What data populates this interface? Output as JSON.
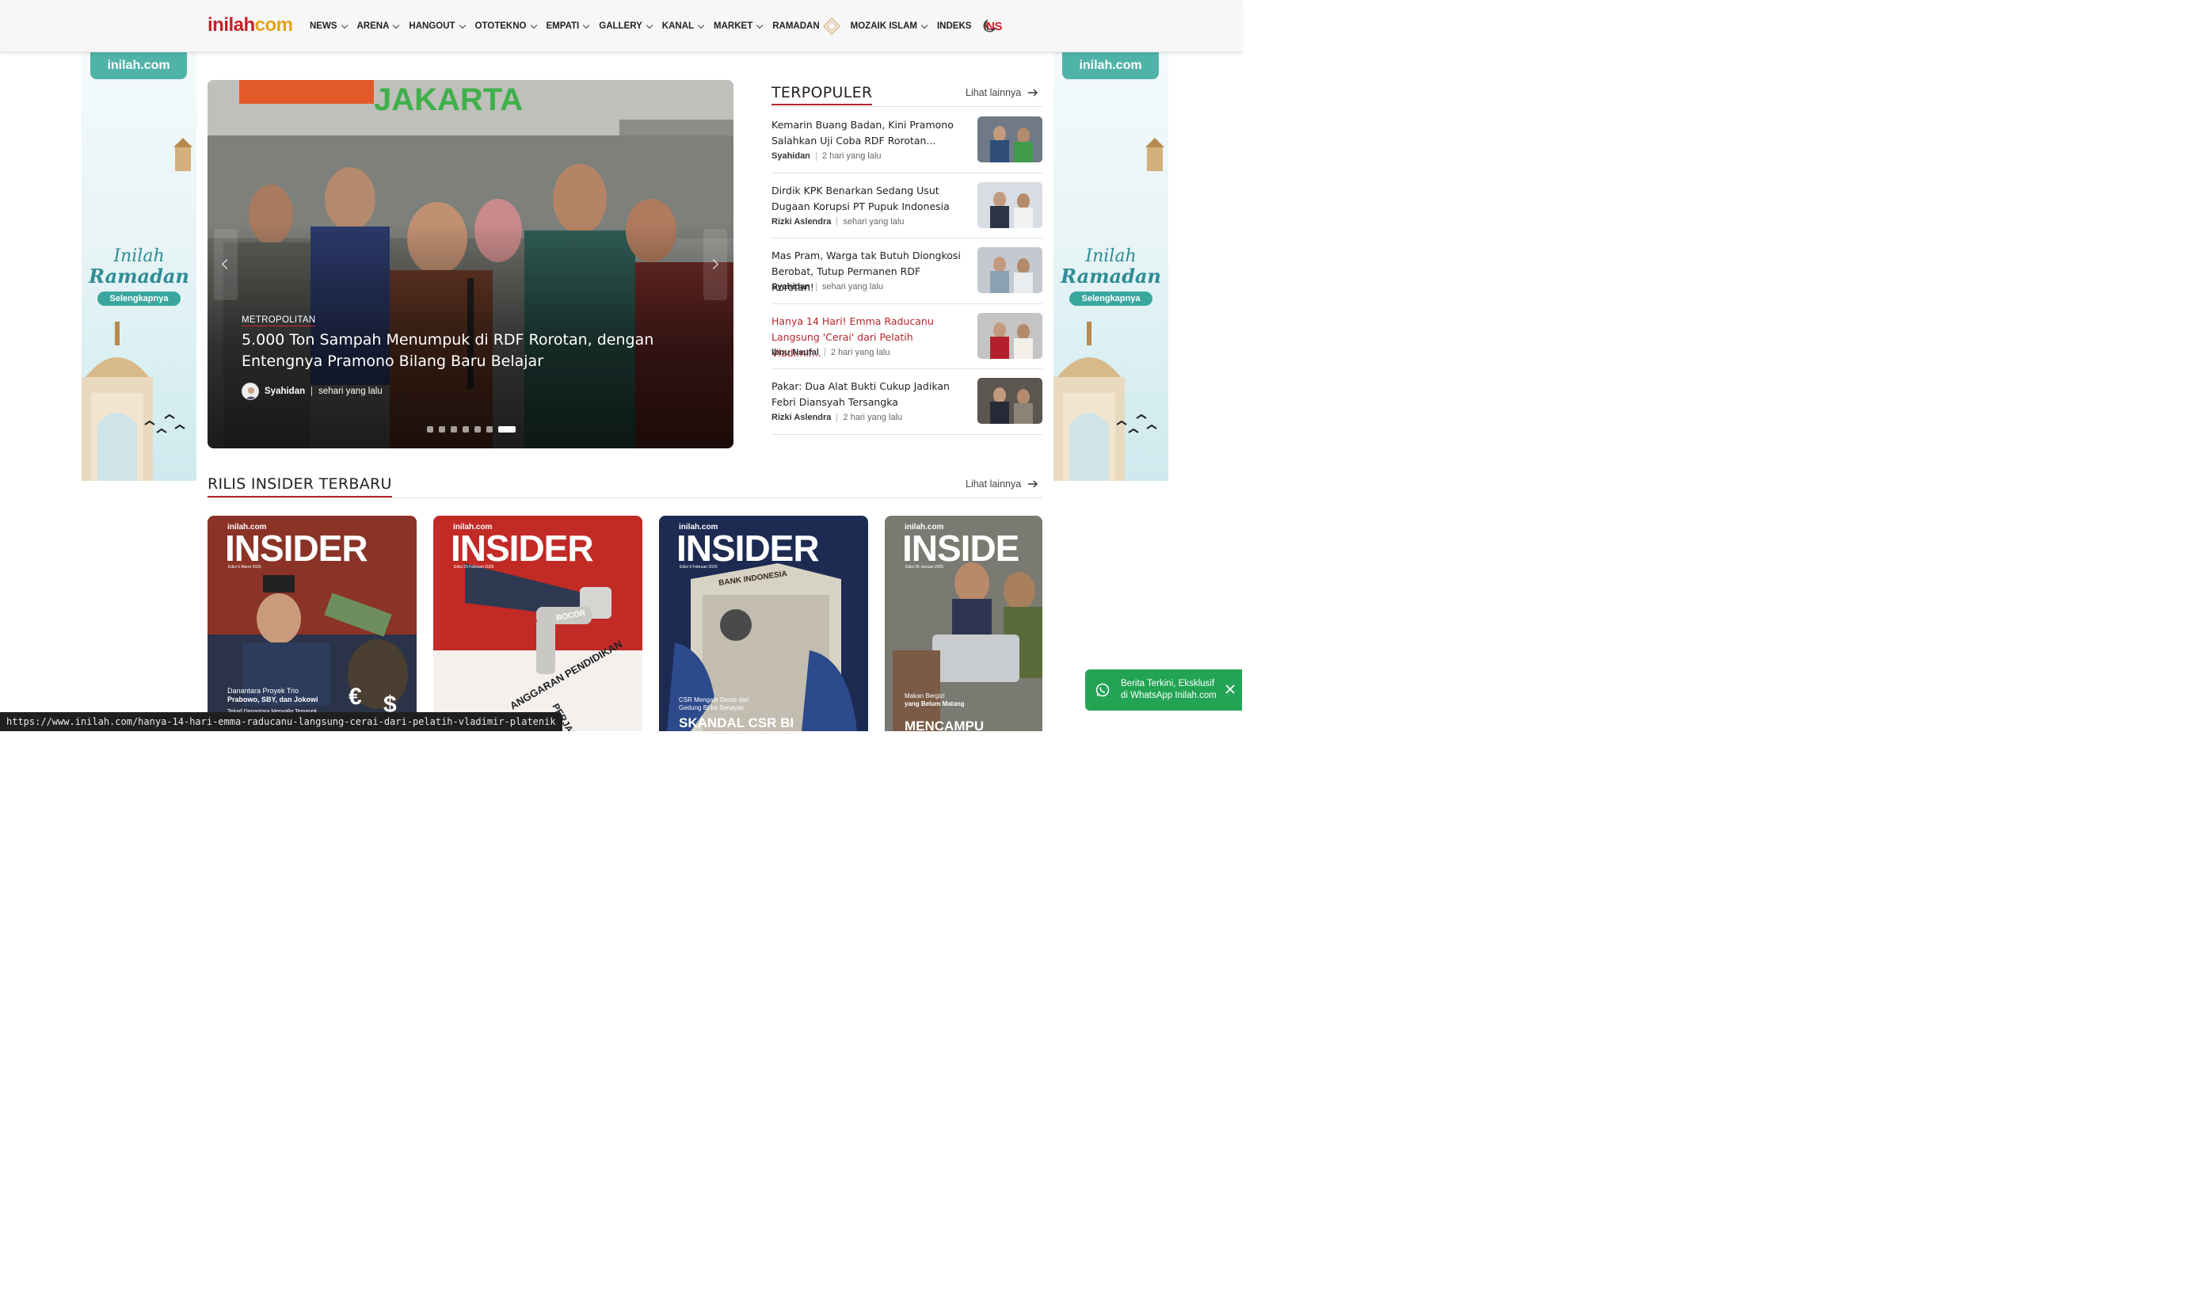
{
  "header": {
    "logo_part1": "inilah",
    "logo_part2": "com",
    "nav": [
      {
        "label": "NEWS",
        "has_dropdown": true
      },
      {
        "label": "ARENA",
        "has_dropdown": true
      },
      {
        "label": "HANGOUT",
        "has_dropdown": true
      },
      {
        "label": "OTOTEKNO",
        "has_dropdown": true
      },
      {
        "label": "EMPATI",
        "has_dropdown": true
      },
      {
        "label": "GALLERY",
        "has_dropdown": true
      },
      {
        "label": "KANAL",
        "has_dropdown": true
      },
      {
        "label": "MARKET",
        "has_dropdown": true
      },
      {
        "label": "RAMADAN",
        "has_dropdown": false
      },
      {
        "label": "MOZAIK ISLAM",
        "has_dropdown": true
      },
      {
        "label": "INDEKS",
        "has_dropdown": false
      }
    ],
    "ins_label": "INS",
    "theme_icon": "moon-icon"
  },
  "side_banner": {
    "logo": "inilah.com",
    "title_line1": "Inilah",
    "title_line2": "Ramadan",
    "button": "Selengkapnya"
  },
  "hero": {
    "category": "METROPOLITAN",
    "title": "5.000 Ton Sampah Menumpuk di RDF Rorotan, dengan Entengnya Pramono Bilang Baru Belajar",
    "author": "Syahidan",
    "time": "sehari yang lalu",
    "sign_text": "JAKARTA",
    "slide_count": 7,
    "active_slide": 7
  },
  "popular": {
    "title": "TERPOPULER",
    "see_more": "Lihat lainnya",
    "items": [
      {
        "title": "Kemarin Buang Badan, Kini Pramono Salahkan Uji Coba RDF Rorotan...",
        "author": "Syahidan",
        "time": "2 hari yang lalu",
        "highlighted": false
      },
      {
        "title": "Dirdik KPK Benarkan Sedang Usut Dugaan Korupsi PT Pupuk Indonesia",
        "author": "Rizki Aslendra",
        "time": "sehari yang lalu",
        "highlighted": false
      },
      {
        "title": "Mas Pram, Warga tak Butuh Diongkosi Berobat, Tutup Permanen RDF Rorotan!",
        "author": "Syahidan",
        "time": "sehari yang lalu",
        "highlighted": false
      },
      {
        "title": "Hanya 14 Hari! Emma Raducanu Langsung 'Cerai' dari Pelatih Vladimir...",
        "author": "Ibnu Naufal",
        "time": "2 hari yang lalu",
        "highlighted": true
      },
      {
        "title": "Pakar: Dua Alat Bukti Cukup Jadikan Febri Diansyah Tersangka",
        "author": "Rizki Aslendra",
        "time": "2 hari yang lalu",
        "highlighted": false
      }
    ]
  },
  "insider": {
    "title": "RILIS INSIDER TERBARU",
    "see_more": "Lihat lainnya",
    "covers": [
      {
        "brand_small": "inilah.com",
        "brand": "INSIDER",
        "edition": "Edisi 6 Maret 2025",
        "caption_line1": "Danantara Proyek Trio",
        "caption_line2": "Prabowo, SBY, dan Jokowi",
        "caption_line3": "Tekad Danantara Menyalip Temasek",
        "bg": "#8a3326"
      },
      {
        "brand_small": "inilah.com",
        "brand": "INSIDER",
        "edition": "Edisi 23 Februari 2025",
        "tap_label": "BOCOR",
        "bg": "#c22a26"
      },
      {
        "brand_small": "inilah.com",
        "brand": "INSIDER",
        "edition": "Edisi 9 Februari 2025",
        "building_label": "BANK INDONESIA",
        "caption_line1": "CSR Mengalir Deras dari",
        "caption_line2": "Gedung BI ke Senayan",
        "headline": "SKANDAL CSR BI",
        "bg": "#1d2a52"
      },
      {
        "brand_small": "inilah.com",
        "brand": "INSIDE",
        "edition": "Edisi 26 Januari 2025",
        "caption_line1": "Makan Bergizi",
        "caption_line2": "yang Belum Matang",
        "headline": "MENCAMPU",
        "bg": "#7a7a72"
      }
    ]
  },
  "whatsapp": {
    "text_line1": "Berita Terkini, Eksklusif",
    "text_line2": "di WhatsApp Inilah.com"
  },
  "status_url": "https://www.inilah.com/hanya-14-hari-emma-raducanu-langsung-cerai-dari-pelatih-vladimir-platenik",
  "colors": {
    "brand_red": "#c62026",
    "brand_gold": "#e6a316",
    "accent_underline": "#b8242a",
    "whatsapp_green": "#23a455",
    "banner_teal": "#3aa79f"
  }
}
